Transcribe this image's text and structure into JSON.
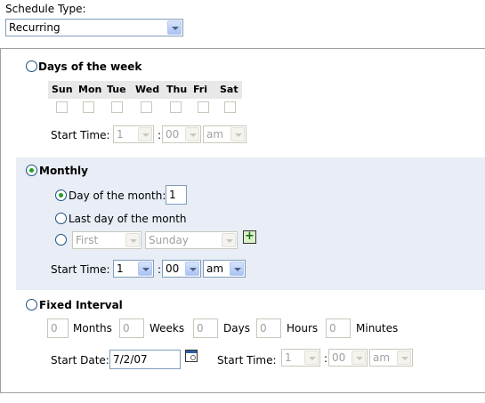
{
  "schedule_type": {
    "label": "Schedule Type:",
    "value": "Recurring"
  },
  "days_of_week": {
    "label": "Days of the week",
    "selected": false,
    "days": [
      "Sun",
      "Mon",
      "Tue",
      "Wed",
      "Thu",
      "Fri",
      "Sat"
    ],
    "start_time_label": "Start Time:",
    "hour": "1",
    "minute": "00",
    "ampm": "am"
  },
  "monthly": {
    "label": "Monthly",
    "selected": true,
    "day_of_month_label": "Day of the month:",
    "day_of_month_value": "1",
    "last_day_label": "Last day of the month",
    "ordinal_value": "First",
    "weekday_value": "Sunday",
    "start_time_label": "Start Time:",
    "hour": "1",
    "minute": "00",
    "ampm": "am"
  },
  "fixed_interval": {
    "label": "Fixed Interval",
    "selected": false,
    "months_value": "0",
    "months_label": "Months",
    "weeks_value": "0",
    "weeks_label": "Weeks",
    "days_value": "0",
    "days_label": "Days",
    "hours_value": "0",
    "hours_label": "Hours",
    "minutes_value": "0",
    "minutes_label": "Minutes",
    "start_date_label": "Start Date:",
    "start_date_value": "7/2/07",
    "start_time_label": "Start Time:",
    "hour": "1",
    "minute": "00",
    "ampm": "am"
  },
  "separator": ":"
}
